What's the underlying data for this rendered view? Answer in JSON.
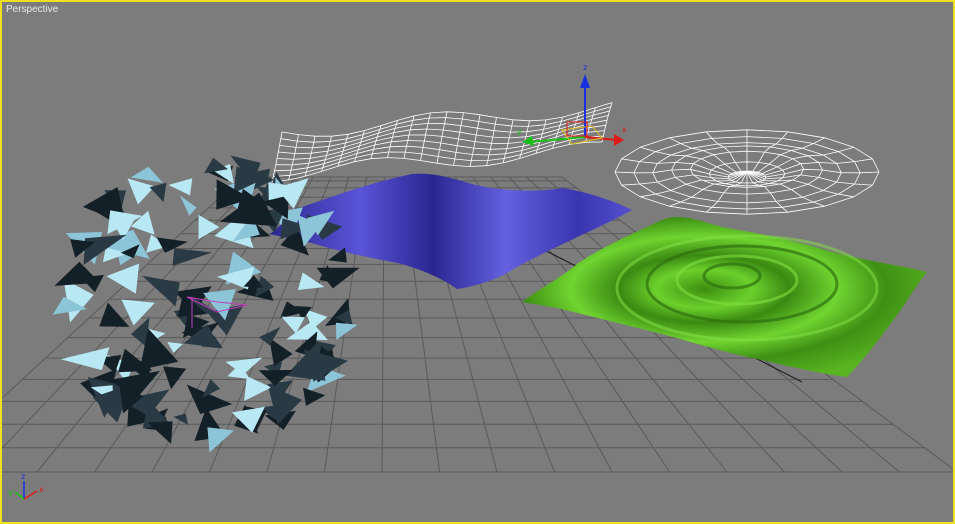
{
  "viewport": {
    "label": "Perspective",
    "border_color": "#f0e020",
    "background_color": "#7c7c7c"
  },
  "gizmo": {
    "x_label": "x",
    "y_label": "y",
    "z_label": "z"
  },
  "axis_tripod": {
    "x_label": "x",
    "y_label": "y",
    "z_label": "z"
  },
  "colors": {
    "grid": "#5a5a5a",
    "wire": "#ffffff",
    "blue_plane": "#4a44c8",
    "green_surface": "#4aa81a",
    "shards_light": "#b8e8f4",
    "shards_dark": "#142028",
    "axis_x": "#e01818",
    "axis_y": "#18c018",
    "axis_z": "#1830e0"
  },
  "objects": [
    {
      "name": "wireframe-wave-plane"
    },
    {
      "name": "wireframe-ripple-disc"
    },
    {
      "name": "blue-wave-plane"
    },
    {
      "name": "green-ripple-surface"
    },
    {
      "name": "shard-sphere"
    }
  ]
}
